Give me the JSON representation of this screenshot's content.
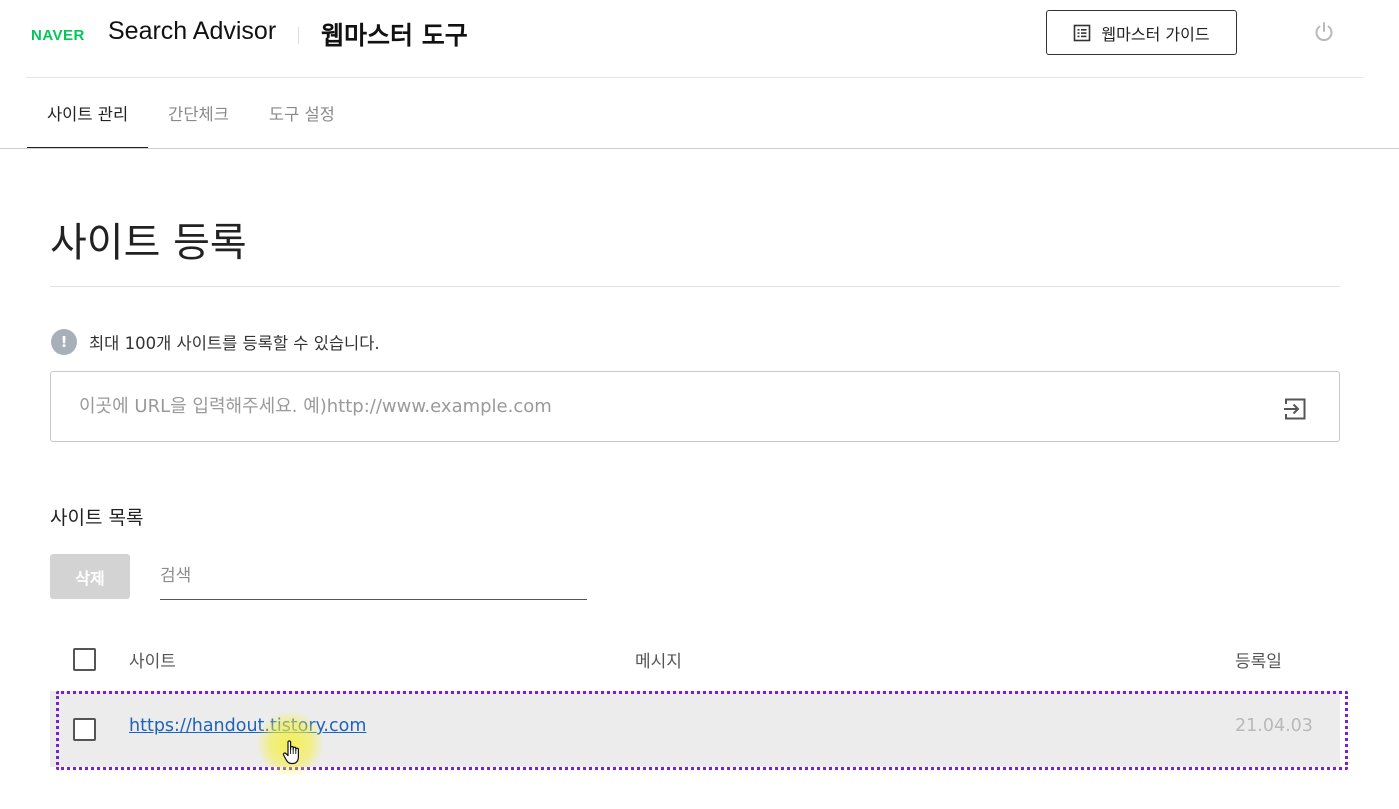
{
  "header": {
    "logo_text": "NAVER",
    "product_name": "Search Advisor",
    "section_title": "웹마스터 도구",
    "guide_button_label": "웹마스터 가이드",
    "guide_icon": "document-list-icon",
    "power_icon": "power-icon"
  },
  "tabs": [
    {
      "label": "사이트 관리",
      "active": true
    },
    {
      "label": "간단체크",
      "active": false
    },
    {
      "label": "도구 설정",
      "active": false
    }
  ],
  "main": {
    "page_title": "사이트 등록",
    "notice": {
      "icon_glyph": "!",
      "text": "최대 100개 사이트를 등록할 수 있습니다."
    },
    "url_input": {
      "value": "",
      "placeholder": "이곳에 URL을 입력해주세요. 예)http://www.example.com",
      "submit_icon": "enter-icon"
    },
    "site_list": {
      "title": "사이트 목록",
      "delete_label": "삭제",
      "search_placeholder": "검색",
      "columns": {
        "site": "사이트",
        "message": "메시지",
        "date": "등록일"
      },
      "rows": [
        {
          "url": "https://handout.tistory.com",
          "message": "",
          "date": "21.04.03",
          "checked": false
        }
      ]
    }
  },
  "colors": {
    "naver_green": "#03c75a",
    "link_blue": "#1f63b8",
    "highlight_outline": "#7b1fd6",
    "row_background": "#ececec",
    "disabled_button": "#d3d3d3"
  }
}
